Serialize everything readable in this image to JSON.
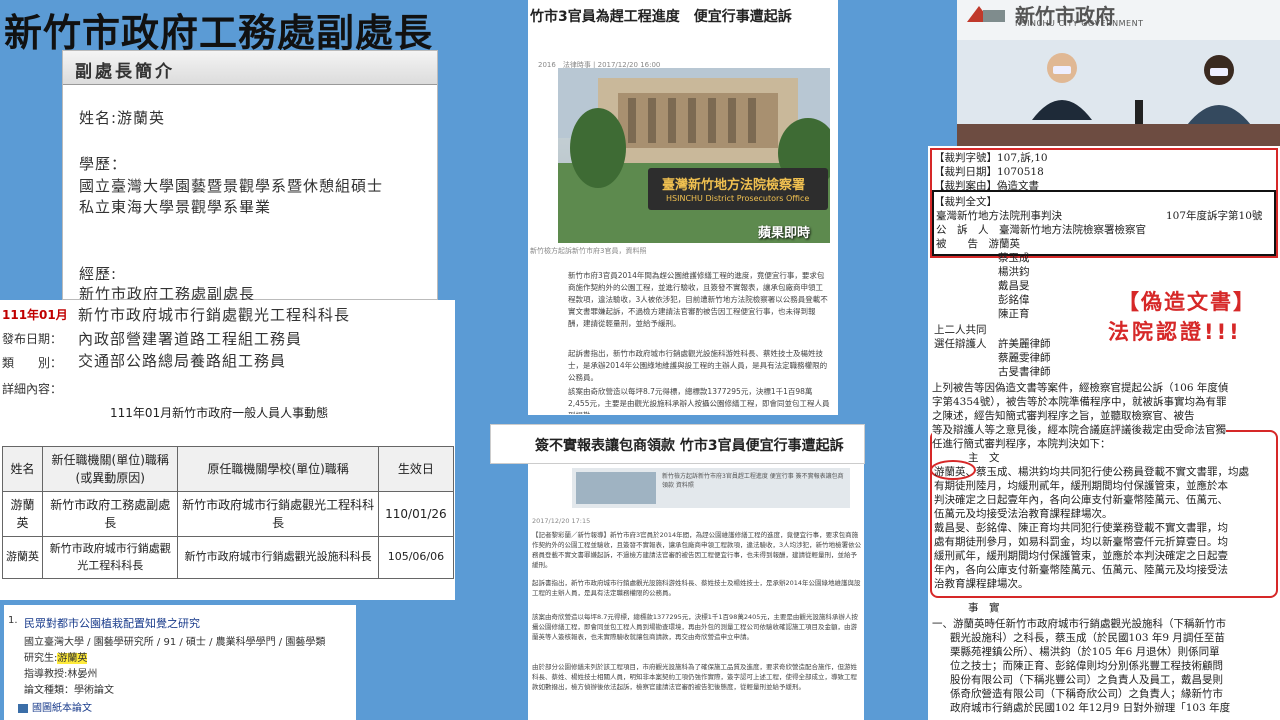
{
  "title": "新竹市政府工務處副處長",
  "profile": {
    "header": "副處長簡介",
    "name_line": "姓名:游蘭英",
    "education_label": "學歷：",
    "education": [
      "國立臺灣大學園藝暨景觀學系暨休憩組碩士",
      "私立東海大學景觀學系畢業"
    ],
    "experience_label": "經歷:",
    "experience": [
      "新竹市政府工務處副處長",
      "新竹市政府城市行銷處觀光工程科科長",
      "內政部營建署道路工程組工務員",
      "交通部公路總局養路組工務員"
    ]
  },
  "announcement": {
    "red_label": "111年01月",
    "labels": [
      "發布日期：",
      "類　　別：",
      "詳細內容："
    ],
    "subtitle": "111年01月新竹市政府一般人員人事動態",
    "table": {
      "headers": [
        "姓名",
        "新任職機關(單位)職稱(或異動原因)",
        "原任職機關學校(單位)職稱",
        "生效日"
      ],
      "rows": [
        [
          "游蘭英",
          "新竹市政府工務處副處長",
          "新竹市政府城市行銷處觀光工程科科長",
          "110/01/26"
        ],
        [
          "游蘭英",
          "新竹市政府城市行銷處觀光工程科科長",
          "新竹市政府城市行銷處觀光設施科科長",
          "105/06/06"
        ]
      ]
    }
  },
  "research": {
    "index": "1.",
    "title": "民眾對都市公園植栽配置知覺之研究",
    "school": "國立臺灣大學 / 園藝學研究所 / 91 / 碩士 / 農業科學學門 / 園藝學類",
    "student_label": "研究生:",
    "student": "游蘭英",
    "advisor": "指導教授:林晏州",
    "type": "論文種類：學術論文",
    "paper": "國圖紙本論文"
  },
  "news1": {
    "title": "竹市3官員為趕工程進度　便宜行事遭起訴",
    "meta": "2016　法律時事 | 2017/12/20 16:00",
    "sign_zh": "臺灣新竹地方法院檢察署",
    "sign_en": "HSINCHU District Prosecutors Office",
    "watermark": "蘋果即時",
    "caption": "新竹檢方起訴新竹市府3官員，資料照",
    "p1": "新竹市府3官員2014年間為趕公園維護修繕工程的進度，竟便宜行事，要求包商施作契約外的公園工程，並進行驗收，且簽發不實報表，讓承包廠商申領工程款項，違法驗收，3人被依涉犯，目前遭新竹地方法院檢察署以公務員登載不實文書罪嫌起訴，不過檢方建請法官審酌被告因工程便宜行事，也未得到報酬，建請從輕量刑，並給予緩刑。",
    "p2": "起訴書指出，新竹市政府城市行銷處觀光設施科游姓科長、蔡姓技士及楊姓技士，是承辦2014年公園綠地維護與設工程的主辦人員，是具有法定職務權限的公務員。",
    "p3": "該案由奇欣營造以每坪8.7元得標，總標款1377295元，決標1千1百98萬2,455元，主要是由觀光設施科承辦人按攝公園修繕工程，即會同並包工程人員到場勘"
  },
  "news2": {
    "title": "簽不實報表讓包商領款 竹市3官員便宜行事遭起訴",
    "img_text": "新竹檢方起訴新竹市府3官員趕工程進度 便宜行事 簽不實報表讓包商領款 資料照",
    "meta": "2017/12/20 17:15",
    "p1": "【記者黎彩蘭／新竹報導】新竹市府3官員於2014年間，為趕公園維護修繕工程的進度，竟便宜行事，要求包商施作契約外的公園工程並驗收，且簽發不實報表，讓承包廠商申領工程款項，違法驗收，3人均涉犯，新竹地檢署依公務員登載不實文書罪嫌起訴，不過檢方建請法官審酌被告因工程便宜行事，也未得到報酬，建請從輕量刑，並給予緩刑。",
    "p2": "起訴書指出，新竹市政府城市行銷處觀光設施科游姓科長、蔡姓技士及楊姓技士，是承辦2014年公園綠地維護與設工程的主辦人員，是具有法定職務權限的公務員。",
    "p3": "該案由奇欣營造以每坪8.7元得標，總標款1377295元，決標1千1百98萬2405元，主要是由觀光設施科承辦人按攝公園修繕工程，即會同並包工程人員到場勘查環境，再由外包的測量工程公司依驗收確認施工項目及金額，由游蘭英等人簽核報表，也未實際驗收就讓包商請款，再交由奇欣營造申立申請。",
    "p4": "由於部分公園修繕未列於該工程項目，市府觀光設施科為了確保施工品質及進度，要求奇欣營造配合施作，但游姓科長、蔡姓、楊姓技士相關人員，明知非本案契約工項仍強作實際，簽字認可上述工程，使得全部成立，導致工程款如數撥出，檢方偵辦後依法起訴，檢察官建請法官審酌被告犯後態度，從輕量刑並給予緩刑。"
  },
  "citygov": {
    "name": "新竹市政府",
    "en": "HSINCHU CITY GOVERNMENT"
  },
  "verdict": {
    "f1": "【裁判字號】107,訴,10",
    "f2": "【裁判日期】1070518",
    "f3": "【裁判案由】偽造文書",
    "f4": "【裁判全文】",
    "court": "臺灣新竹地方法院刑事判決",
    "case_no": "107年度訴字第10號",
    "prosecutor": "公　訴　人　臺灣新竹地方法院檢察署檢察官",
    "defendant": "被　　告　游蘭英",
    "others": [
      "蔡玉成",
      "楊洪鈞",
      "戴昌旻",
      "彭銘偉",
      "陳正育"
    ],
    "joint": "上二人共同",
    "counsel_label": "選任辯護人",
    "lawyers": [
      "許美麗律師",
      "蔡麗雯律師",
      "古旻書律師"
    ],
    "forgery": "【偽造文書】",
    "certified": "法院認證!!!",
    "body": [
      "上列被告等因偽造文書等案件，經檢察官提起公訴（106 年度偵",
      "字第4354號），被告等於本院準備程序中，就被訴事實均為有罪",
      "之陳述，經告知簡式審判程序之旨，並聽取檢察官、被告",
      "等及辯護人等之意見後，經本院合議庭評議後裁定由受命法官獨",
      "任進行簡式審判程序，本院判決如下："
    ],
    "main_label": "主　文",
    "main": [
      "游蘭英、蔡玉成、楊洪鈞均共同犯行使公務員登載不實文書罪，均處",
      "有期徒刑陸月，均緩刑貳年，緩刑期間均付保護管束，並應於本",
      "判決確定之日起壹年內，各向公庫支付新臺幣陸萬元、伍萬元、",
      "伍萬元及均接受法治教育課程肆場次。",
      "戴昌旻、彭銘偉、陳正育均共同犯行使業務登載不實文書罪，均",
      "處有期徒刑參月，如易科罰金，均以新臺幣壹仟元折算壹日。均",
      "緩刑貳年，緩刑期間均付保護管束，並應於本判決確定之日起壹",
      "年內，各向公庫支付新臺幣陸萬元、伍萬元、陸萬元及均接受法",
      "治教育課程肆場次。"
    ],
    "facts_label": "事　實",
    "facts": [
      "一、游蘭英時任新竹市政府城市行銷處觀光設施科（下稱新竹市",
      "觀光設施科）之科長，蔡玉成（於民國103 年9 月調任至苗",
      "栗縣苑裡鎮公所）、楊洪鈞（於105 年6 月退休）則係同單",
      "位之技士；而陳正育、彭銘偉則均分別係兆豐工程技術顧問",
      "股份有限公司（下稱兆豐公司）之負責人及員工，戴昌旻則",
      "係奇欣營造有限公司（下稱奇欣公司）之負責人；緣新竹市",
      "政府城市行銷處於民國102 年12月9 日對外辦理「103 年度"
    ]
  }
}
